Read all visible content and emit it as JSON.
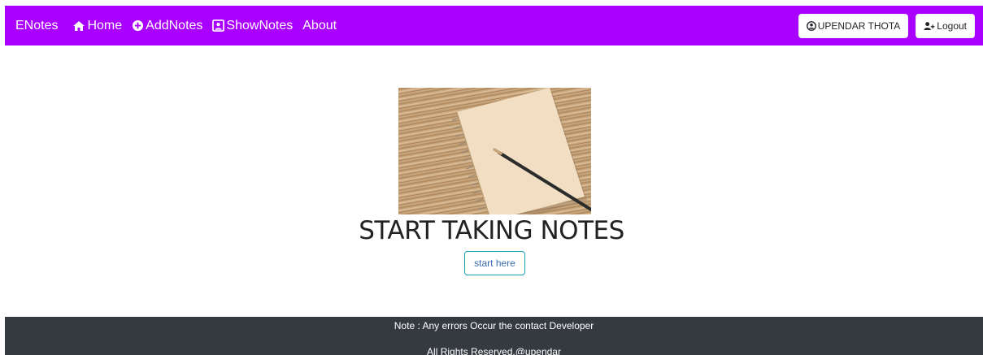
{
  "navbar": {
    "brand": "ENotes",
    "links": [
      {
        "label": "Home",
        "icon": "home-icon"
      },
      {
        "label": "AddNotes",
        "icon": "plus-circle-icon"
      },
      {
        "label": "ShowNotes",
        "icon": "user-square-icon"
      },
      {
        "label": "About",
        "icon": ""
      }
    ],
    "user_button": {
      "label": "UPENDAR THOTA",
      "icon": "user-circle-icon"
    },
    "logout_button": {
      "label": "Logout",
      "icon": "user-plus-icon"
    },
    "background_color": "#aa00ff"
  },
  "hero": {
    "image": "notebook-with-pencil-on-wooden-table",
    "title": "START TAKING NOTES",
    "button_label": "start here",
    "button_border_color": "#17a2b8"
  },
  "footer": {
    "line1": "Note : Any errors Occur the contact Developer",
    "line2": "All Rights Reserved,@upendar",
    "background_color": "#343a40"
  }
}
